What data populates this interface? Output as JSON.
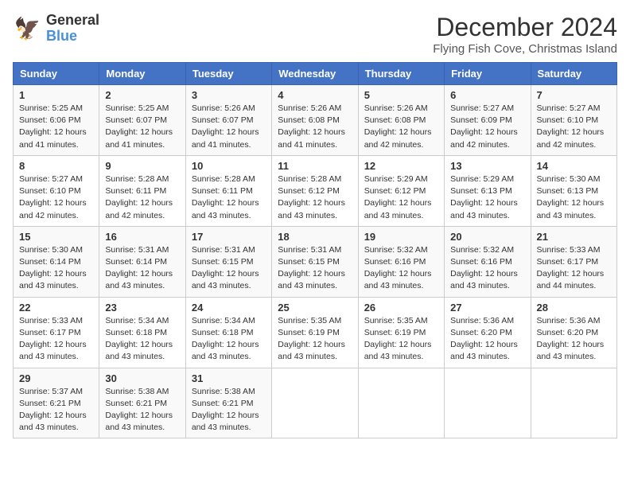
{
  "logo": {
    "line1": "General",
    "line2": "Blue"
  },
  "title": "December 2024",
  "location": "Flying Fish Cove, Christmas Island",
  "days_of_week": [
    "Sunday",
    "Monday",
    "Tuesday",
    "Wednesday",
    "Thursday",
    "Friday",
    "Saturday"
  ],
  "weeks": [
    [
      {
        "day": "1",
        "sunrise": "Sunrise: 5:25 AM",
        "sunset": "Sunset: 6:06 PM",
        "daylight": "Daylight: 12 hours and 41 minutes."
      },
      {
        "day": "2",
        "sunrise": "Sunrise: 5:25 AM",
        "sunset": "Sunset: 6:07 PM",
        "daylight": "Daylight: 12 hours and 41 minutes."
      },
      {
        "day": "3",
        "sunrise": "Sunrise: 5:26 AM",
        "sunset": "Sunset: 6:07 PM",
        "daylight": "Daylight: 12 hours and 41 minutes."
      },
      {
        "day": "4",
        "sunrise": "Sunrise: 5:26 AM",
        "sunset": "Sunset: 6:08 PM",
        "daylight": "Daylight: 12 hours and 41 minutes."
      },
      {
        "day": "5",
        "sunrise": "Sunrise: 5:26 AM",
        "sunset": "Sunset: 6:08 PM",
        "daylight": "Daylight: 12 hours and 42 minutes."
      },
      {
        "day": "6",
        "sunrise": "Sunrise: 5:27 AM",
        "sunset": "Sunset: 6:09 PM",
        "daylight": "Daylight: 12 hours and 42 minutes."
      },
      {
        "day": "7",
        "sunrise": "Sunrise: 5:27 AM",
        "sunset": "Sunset: 6:10 PM",
        "daylight": "Daylight: 12 hours and 42 minutes."
      }
    ],
    [
      {
        "day": "8",
        "sunrise": "Sunrise: 5:27 AM",
        "sunset": "Sunset: 6:10 PM",
        "daylight": "Daylight: 12 hours and 42 minutes."
      },
      {
        "day": "9",
        "sunrise": "Sunrise: 5:28 AM",
        "sunset": "Sunset: 6:11 PM",
        "daylight": "Daylight: 12 hours and 42 minutes."
      },
      {
        "day": "10",
        "sunrise": "Sunrise: 5:28 AM",
        "sunset": "Sunset: 6:11 PM",
        "daylight": "Daylight: 12 hours and 43 minutes."
      },
      {
        "day": "11",
        "sunrise": "Sunrise: 5:28 AM",
        "sunset": "Sunset: 6:12 PM",
        "daylight": "Daylight: 12 hours and 43 minutes."
      },
      {
        "day": "12",
        "sunrise": "Sunrise: 5:29 AM",
        "sunset": "Sunset: 6:12 PM",
        "daylight": "Daylight: 12 hours and 43 minutes."
      },
      {
        "day": "13",
        "sunrise": "Sunrise: 5:29 AM",
        "sunset": "Sunset: 6:13 PM",
        "daylight": "Daylight: 12 hours and 43 minutes."
      },
      {
        "day": "14",
        "sunrise": "Sunrise: 5:30 AM",
        "sunset": "Sunset: 6:13 PM",
        "daylight": "Daylight: 12 hours and 43 minutes."
      }
    ],
    [
      {
        "day": "15",
        "sunrise": "Sunrise: 5:30 AM",
        "sunset": "Sunset: 6:14 PM",
        "daylight": "Daylight: 12 hours and 43 minutes."
      },
      {
        "day": "16",
        "sunrise": "Sunrise: 5:31 AM",
        "sunset": "Sunset: 6:14 PM",
        "daylight": "Daylight: 12 hours and 43 minutes."
      },
      {
        "day": "17",
        "sunrise": "Sunrise: 5:31 AM",
        "sunset": "Sunset: 6:15 PM",
        "daylight": "Daylight: 12 hours and 43 minutes."
      },
      {
        "day": "18",
        "sunrise": "Sunrise: 5:31 AM",
        "sunset": "Sunset: 6:15 PM",
        "daylight": "Daylight: 12 hours and 43 minutes."
      },
      {
        "day": "19",
        "sunrise": "Sunrise: 5:32 AM",
        "sunset": "Sunset: 6:16 PM",
        "daylight": "Daylight: 12 hours and 43 minutes."
      },
      {
        "day": "20",
        "sunrise": "Sunrise: 5:32 AM",
        "sunset": "Sunset: 6:16 PM",
        "daylight": "Daylight: 12 hours and 43 minutes."
      },
      {
        "day": "21",
        "sunrise": "Sunrise: 5:33 AM",
        "sunset": "Sunset: 6:17 PM",
        "daylight": "Daylight: 12 hours and 44 minutes."
      }
    ],
    [
      {
        "day": "22",
        "sunrise": "Sunrise: 5:33 AM",
        "sunset": "Sunset: 6:17 PM",
        "daylight": "Daylight: 12 hours and 43 minutes."
      },
      {
        "day": "23",
        "sunrise": "Sunrise: 5:34 AM",
        "sunset": "Sunset: 6:18 PM",
        "daylight": "Daylight: 12 hours and 43 minutes."
      },
      {
        "day": "24",
        "sunrise": "Sunrise: 5:34 AM",
        "sunset": "Sunset: 6:18 PM",
        "daylight": "Daylight: 12 hours and 43 minutes."
      },
      {
        "day": "25",
        "sunrise": "Sunrise: 5:35 AM",
        "sunset": "Sunset: 6:19 PM",
        "daylight": "Daylight: 12 hours and 43 minutes."
      },
      {
        "day": "26",
        "sunrise": "Sunrise: 5:35 AM",
        "sunset": "Sunset: 6:19 PM",
        "daylight": "Daylight: 12 hours and 43 minutes."
      },
      {
        "day": "27",
        "sunrise": "Sunrise: 5:36 AM",
        "sunset": "Sunset: 6:20 PM",
        "daylight": "Daylight: 12 hours and 43 minutes."
      },
      {
        "day": "28",
        "sunrise": "Sunrise: 5:36 AM",
        "sunset": "Sunset: 6:20 PM",
        "daylight": "Daylight: 12 hours and 43 minutes."
      }
    ],
    [
      {
        "day": "29",
        "sunrise": "Sunrise: 5:37 AM",
        "sunset": "Sunset: 6:21 PM",
        "daylight": "Daylight: 12 hours and 43 minutes."
      },
      {
        "day": "30",
        "sunrise": "Sunrise: 5:38 AM",
        "sunset": "Sunset: 6:21 PM",
        "daylight": "Daylight: 12 hours and 43 minutes."
      },
      {
        "day": "31",
        "sunrise": "Sunrise: 5:38 AM",
        "sunset": "Sunset: 6:21 PM",
        "daylight": "Daylight: 12 hours and 43 minutes."
      },
      null,
      null,
      null,
      null
    ]
  ]
}
